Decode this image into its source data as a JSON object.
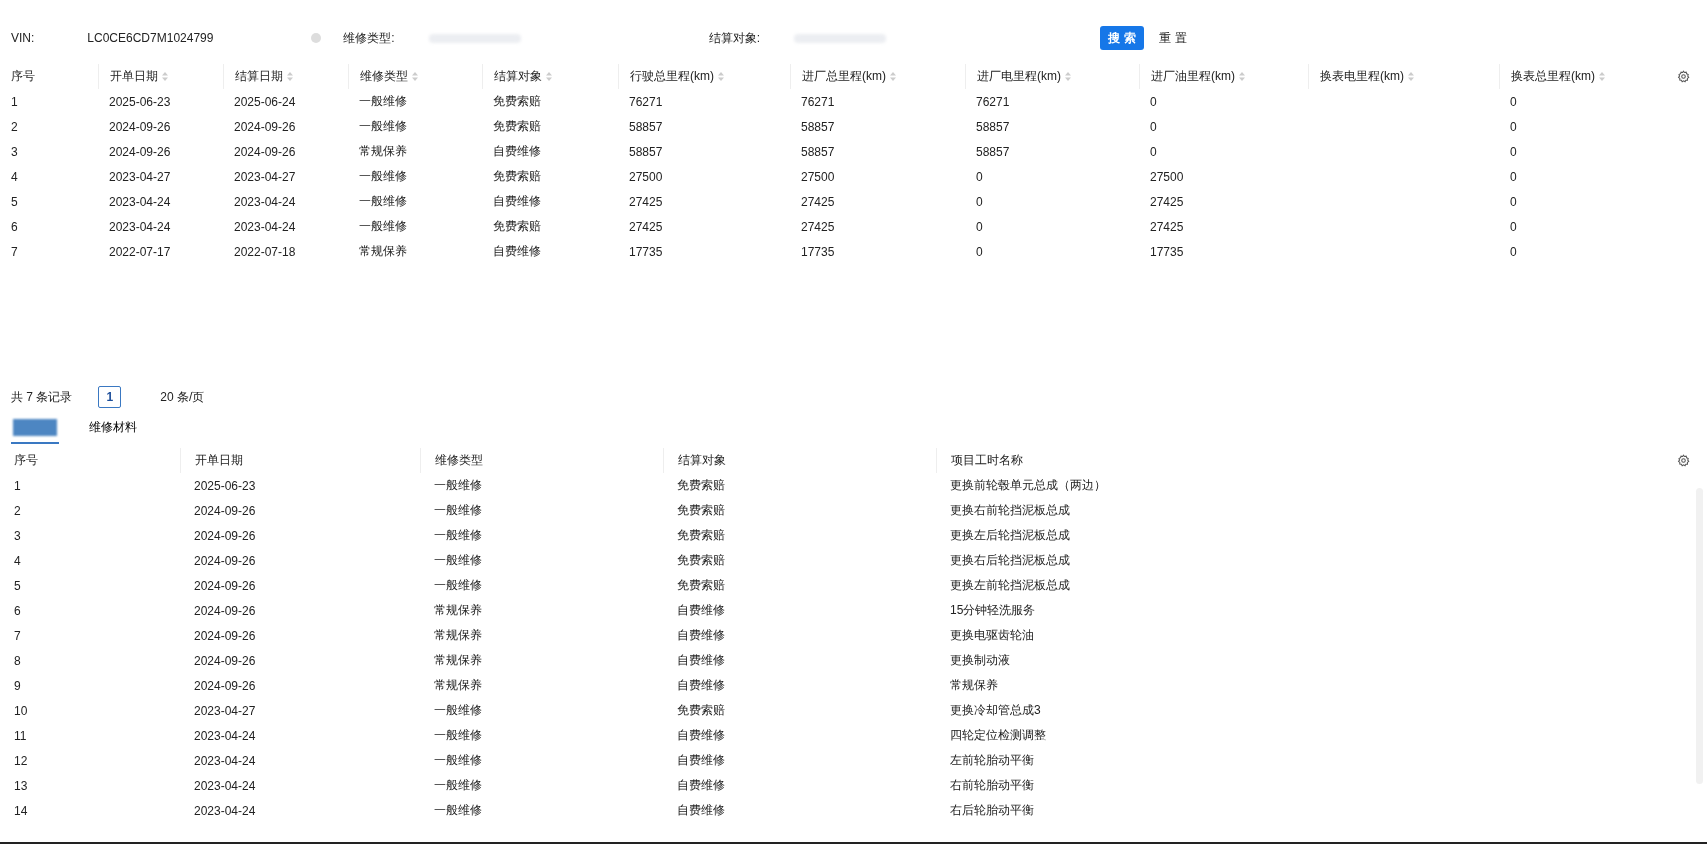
{
  "filters": {
    "vin": {
      "label": "VIN:",
      "value": "LC0CE6CD7M1024799"
    },
    "repair_type": {
      "label": "维修类型:"
    },
    "settle_target": {
      "label": "结算对象:"
    },
    "buttons": [
      {
        "label": "搜 索",
        "kind": "primary"
      },
      {
        "label": "重 置",
        "kind": "text"
      }
    ]
  },
  "orders_table": {
    "columns": [
      {
        "label": "序号",
        "sortable": false
      },
      {
        "label": "开单日期",
        "sortable": true
      },
      {
        "label": "结算日期",
        "sortable": true
      },
      {
        "label": "维修类型",
        "sortable": true
      },
      {
        "label": "结算对象",
        "sortable": true
      },
      {
        "label": "行驶总里程(km)",
        "sortable": true
      },
      {
        "label": "进厂总里程(km)",
        "sortable": true
      },
      {
        "label": "进厂电里程(km)",
        "sortable": true
      },
      {
        "label": "进厂油里程(km)",
        "sortable": true
      },
      {
        "label": "换表电里程(km)",
        "sortable": true
      },
      {
        "label": "换表总里程(km)",
        "sortable": true
      }
    ],
    "rows": [
      [
        "1",
        "2025-06-23",
        "2025-06-24",
        "一般维修",
        "免费索赔",
        "76271",
        "76271",
        "76271",
        "0",
        "",
        "0"
      ],
      [
        "2",
        "2024-09-26",
        "2024-09-26",
        "一般维修",
        "免费索赔",
        "58857",
        "58857",
        "58857",
        "0",
        "",
        "0"
      ],
      [
        "3",
        "2024-09-26",
        "2024-09-26",
        "常规保养",
        "自费维修",
        "58857",
        "58857",
        "58857",
        "0",
        "",
        "0"
      ],
      [
        "4",
        "2023-04-27",
        "2023-04-27",
        "一般维修",
        "免费索赔",
        "27500",
        "27500",
        "0",
        "27500",
        "",
        "0"
      ],
      [
        "5",
        "2023-04-24",
        "2023-04-24",
        "一般维修",
        "自费维修",
        "27425",
        "27425",
        "0",
        "27425",
        "",
        "0"
      ],
      [
        "6",
        "2023-04-24",
        "2023-04-24",
        "一般维修",
        "免费索赔",
        "27425",
        "27425",
        "0",
        "27425",
        "",
        "0"
      ],
      [
        "7",
        "2022-07-17",
        "2022-07-18",
        "常规保养",
        "自费维修",
        "17735",
        "17735",
        "0",
        "17735",
        "",
        "0"
      ]
    ]
  },
  "pagination": {
    "total": "共 7 条记录",
    "pages": [
      {
        "label": "1",
        "selected": true
      }
    ],
    "page_size": "20 条/页"
  },
  "tabs": [
    {
      "selected": true
    },
    {
      "label": "维修材料",
      "selected": false
    }
  ],
  "items_table": {
    "columns": [
      "序号",
      "开单日期",
      "维修类型",
      "结算对象",
      "项目工时名称"
    ],
    "rows": [
      [
        "1",
        "2025-06-23",
        "一般维修",
        "免费索赔",
        "更换前轮毂单元总成（两边）"
      ],
      [
        "2",
        "2024-09-26",
        "一般维修",
        "免费索赔",
        "更换右前轮挡泥板总成"
      ],
      [
        "3",
        "2024-09-26",
        "一般维修",
        "免费索赔",
        "更换左后轮挡泥板总成"
      ],
      [
        "4",
        "2024-09-26",
        "一般维修",
        "免费索赔",
        "更换右后轮挡泥板总成"
      ],
      [
        "5",
        "2024-09-26",
        "一般维修",
        "免费索赔",
        "更换左前轮挡泥板总成"
      ],
      [
        "6",
        "2024-09-26",
        "常规保养",
        "自费维修",
        "15分钟轻洗服务"
      ],
      [
        "7",
        "2024-09-26",
        "常规保养",
        "自费维修",
        "更换电驱齿轮油"
      ],
      [
        "8",
        "2024-09-26",
        "常规保养",
        "自费维修",
        "更换制动液"
      ],
      [
        "9",
        "2024-09-26",
        "常规保养",
        "自费维修",
        "常规保养"
      ],
      [
        "10",
        "2023-04-27",
        "一般维修",
        "免费索赔",
        "更换冷却管总成3"
      ],
      [
        "11",
        "2023-04-24",
        "一般维修",
        "自费维修",
        "四轮定位检测调整"
      ],
      [
        "12",
        "2023-04-24",
        "一般维修",
        "自费维修",
        "左前轮胎动平衡"
      ],
      [
        "13",
        "2023-04-24",
        "一般维修",
        "自费维修",
        "右前轮胎动平衡"
      ],
      [
        "14",
        "2023-04-24",
        "一般维修",
        "自费维修",
        "右后轮胎动平衡"
      ]
    ]
  }
}
